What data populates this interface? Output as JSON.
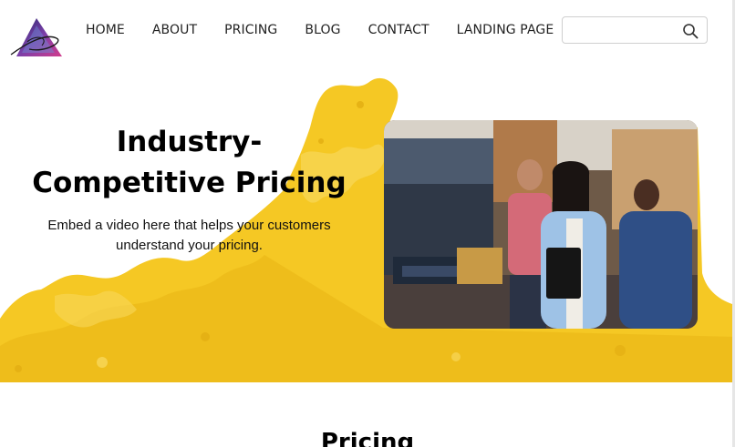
{
  "nav": {
    "items": [
      {
        "label": "HOME"
      },
      {
        "label": "ABOUT"
      },
      {
        "label": "PRICING"
      },
      {
        "label": "BLOG"
      },
      {
        "label": "CONTACT"
      },
      {
        "label": "LANDING PAGE"
      }
    ]
  },
  "search": {
    "value": "",
    "placeholder": ""
  },
  "hero": {
    "title": "Industry-Competitive Pricing",
    "subtitle": "Embed a video here that helps your customers understand your pricing."
  },
  "pricing": {
    "title": "Pricing"
  },
  "colors": {
    "splash": "#f5c824",
    "splash_dark": "#e8b514",
    "nav_text": "#222222"
  },
  "icons": {
    "logo": "triangle-logo-icon",
    "search": "magnifier-icon"
  }
}
